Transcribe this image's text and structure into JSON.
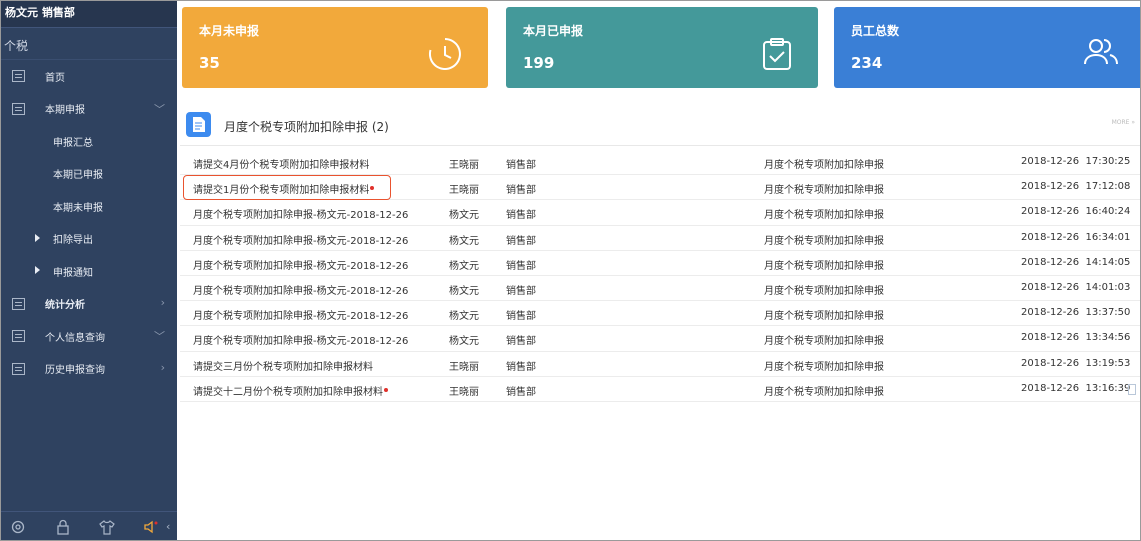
{
  "sidebar": {
    "header": "杨文元  销售部",
    "app_title": "个税",
    "items": [
      {
        "label": "首页"
      },
      {
        "label": "本期申报"
      },
      {
        "label": "申报汇总"
      },
      {
        "label": "本期已申报"
      },
      {
        "label": "本期未申报"
      },
      {
        "label": "扣除导出"
      },
      {
        "label": "申报通知"
      },
      {
        "label": "统计分析"
      },
      {
        "label": "个人信息查询"
      },
      {
        "label": "历史申报查询"
      }
    ],
    "footer_icons": [
      "gear-icon",
      "lock-icon",
      "shirt-icon",
      "speaker-icon",
      "collapse-icon"
    ]
  },
  "cards": [
    {
      "title": "本月未申报",
      "value": "35",
      "icon": "clock-icon",
      "color": "#f2a93b"
    },
    {
      "title": "本月已申报",
      "value": "199",
      "icon": "clipboard-check-icon",
      "color": "#44999a"
    },
    {
      "title": "员工总数",
      "value": "234",
      "icon": "users-icon",
      "color": "#3a7fd6"
    }
  ],
  "section": {
    "title": "月度个税专项附加扣除申报 (2)",
    "more": "MORE »"
  },
  "rows": [
    {
      "title": "请提交4月份个税专项附加扣除申报材料",
      "name": "王晓丽",
      "dept": "销售部",
      "type": "月度个税专项附加扣除申报",
      "date": "2018-12-26",
      "time": "17:30:25",
      "unread": false
    },
    {
      "title": "请提交1月份个税专项附加扣除申报材料",
      "name": "王晓丽",
      "dept": "销售部",
      "type": "月度个税专项附加扣除申报",
      "date": "2018-12-26",
      "time": "17:12:08",
      "unread": true
    },
    {
      "title": "月度个税专项附加扣除申报-杨文元-2018-12-26",
      "name": "杨文元",
      "dept": "销售部",
      "type": "月度个税专项附加扣除申报",
      "date": "2018-12-26",
      "time": "16:40:24",
      "unread": false
    },
    {
      "title": "月度个税专项附加扣除申报-杨文元-2018-12-26",
      "name": "杨文元",
      "dept": "销售部",
      "type": "月度个税专项附加扣除申报",
      "date": "2018-12-26",
      "time": "16:34:01",
      "unread": false
    },
    {
      "title": "月度个税专项附加扣除申报-杨文元-2018-12-26",
      "name": "杨文元",
      "dept": "销售部",
      "type": "月度个税专项附加扣除申报",
      "date": "2018-12-26",
      "time": "14:14:05",
      "unread": false
    },
    {
      "title": "月度个税专项附加扣除申报-杨文元-2018-12-26",
      "name": "杨文元",
      "dept": "销售部",
      "type": "月度个税专项附加扣除申报",
      "date": "2018-12-26",
      "time": "14:01:03",
      "unread": false
    },
    {
      "title": "月度个税专项附加扣除申报-杨文元-2018-12-26",
      "name": "杨文元",
      "dept": "销售部",
      "type": "月度个税专项附加扣除申报",
      "date": "2018-12-26",
      "time": "13:37:50",
      "unread": false
    },
    {
      "title": "月度个税专项附加扣除申报-杨文元-2018-12-26",
      "name": "杨文元",
      "dept": "销售部",
      "type": "月度个税专项附加扣除申报",
      "date": "2018-12-26",
      "time": "13:34:56",
      "unread": false
    },
    {
      "title": "请提交三月份个税专项附加扣除申报材料",
      "name": "王晓丽",
      "dept": "销售部",
      "type": "月度个税专项附加扣除申报",
      "date": "2018-12-26",
      "time": "13:19:53",
      "unread": false
    },
    {
      "title": "请提交十二月份个税专项附加扣除申报材料",
      "name": "王晓丽",
      "dept": "销售部",
      "type": "月度个税专项附加扣除申报",
      "date": "2018-12-26",
      "time": "13:16:39",
      "unread": true
    }
  ]
}
